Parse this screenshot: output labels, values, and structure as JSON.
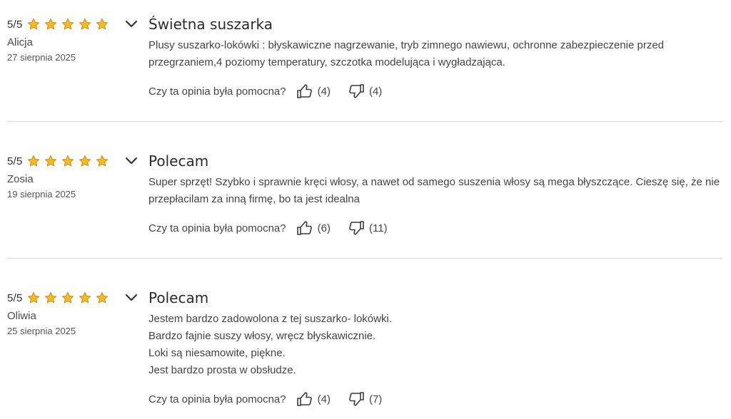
{
  "colors": {
    "star_fill": "#f5b921",
    "star_stroke": "#c98a10",
    "divider": "#d9d9d9",
    "text": "#444444"
  },
  "icons": {
    "star": "star-icon",
    "expand": "chevron-down-icon",
    "up": "thumbs-up-icon",
    "down": "thumbs-down-icon"
  },
  "reviews": [
    {
      "score": "5/5",
      "stars": 5,
      "author": "Alicja",
      "date": "27 sierpnia 2025",
      "title": "Świetna suszarka",
      "lines": [
        "Plusy suszarko-lokówki : błyskawiczne nagrzewanie, tryb zimnego nawiewu, ochronne zabezpieczenie przed",
        "przegrzaniem,4 poziomy temperatury, szczotka modelująca i wygładzająca."
      ],
      "helpful_label": "Czy ta opinia była pomocna?",
      "up_count": "(4)",
      "down_count": "(4)"
    },
    {
      "score": "5/5",
      "stars": 5,
      "author": "Zosia",
      "date": "19 sierpnia 2025",
      "title": "Polecam",
      "lines": [
        "Super sprzęt! Szybko i sprawnie kręci włosy, a nawet od samego suszenia włosy są mega błyszczące. Cieszę się, że nie",
        "przepłacilam za inną firmę, bo ta jest idealna"
      ],
      "helpful_label": "Czy ta opinia była pomocna?",
      "up_count": "(6)",
      "down_count": "(11)"
    },
    {
      "score": "5/5",
      "stars": 5,
      "author": "Oliwia",
      "date": "25 sierpnia 2025",
      "title": "Polecam",
      "lines": [
        "Jestem bardzo zadowolona z tej suszarko- lokówki.",
        "Bardzo fajnie suszy włosy, wręcz błyskawicznie.",
        "Loki są niesamowite, piękne.",
        "Jest bardzo prosta w obsłudze."
      ],
      "helpful_label": "Czy ta opinia była pomocna?",
      "up_count": "(4)",
      "down_count": "(7)"
    }
  ]
}
